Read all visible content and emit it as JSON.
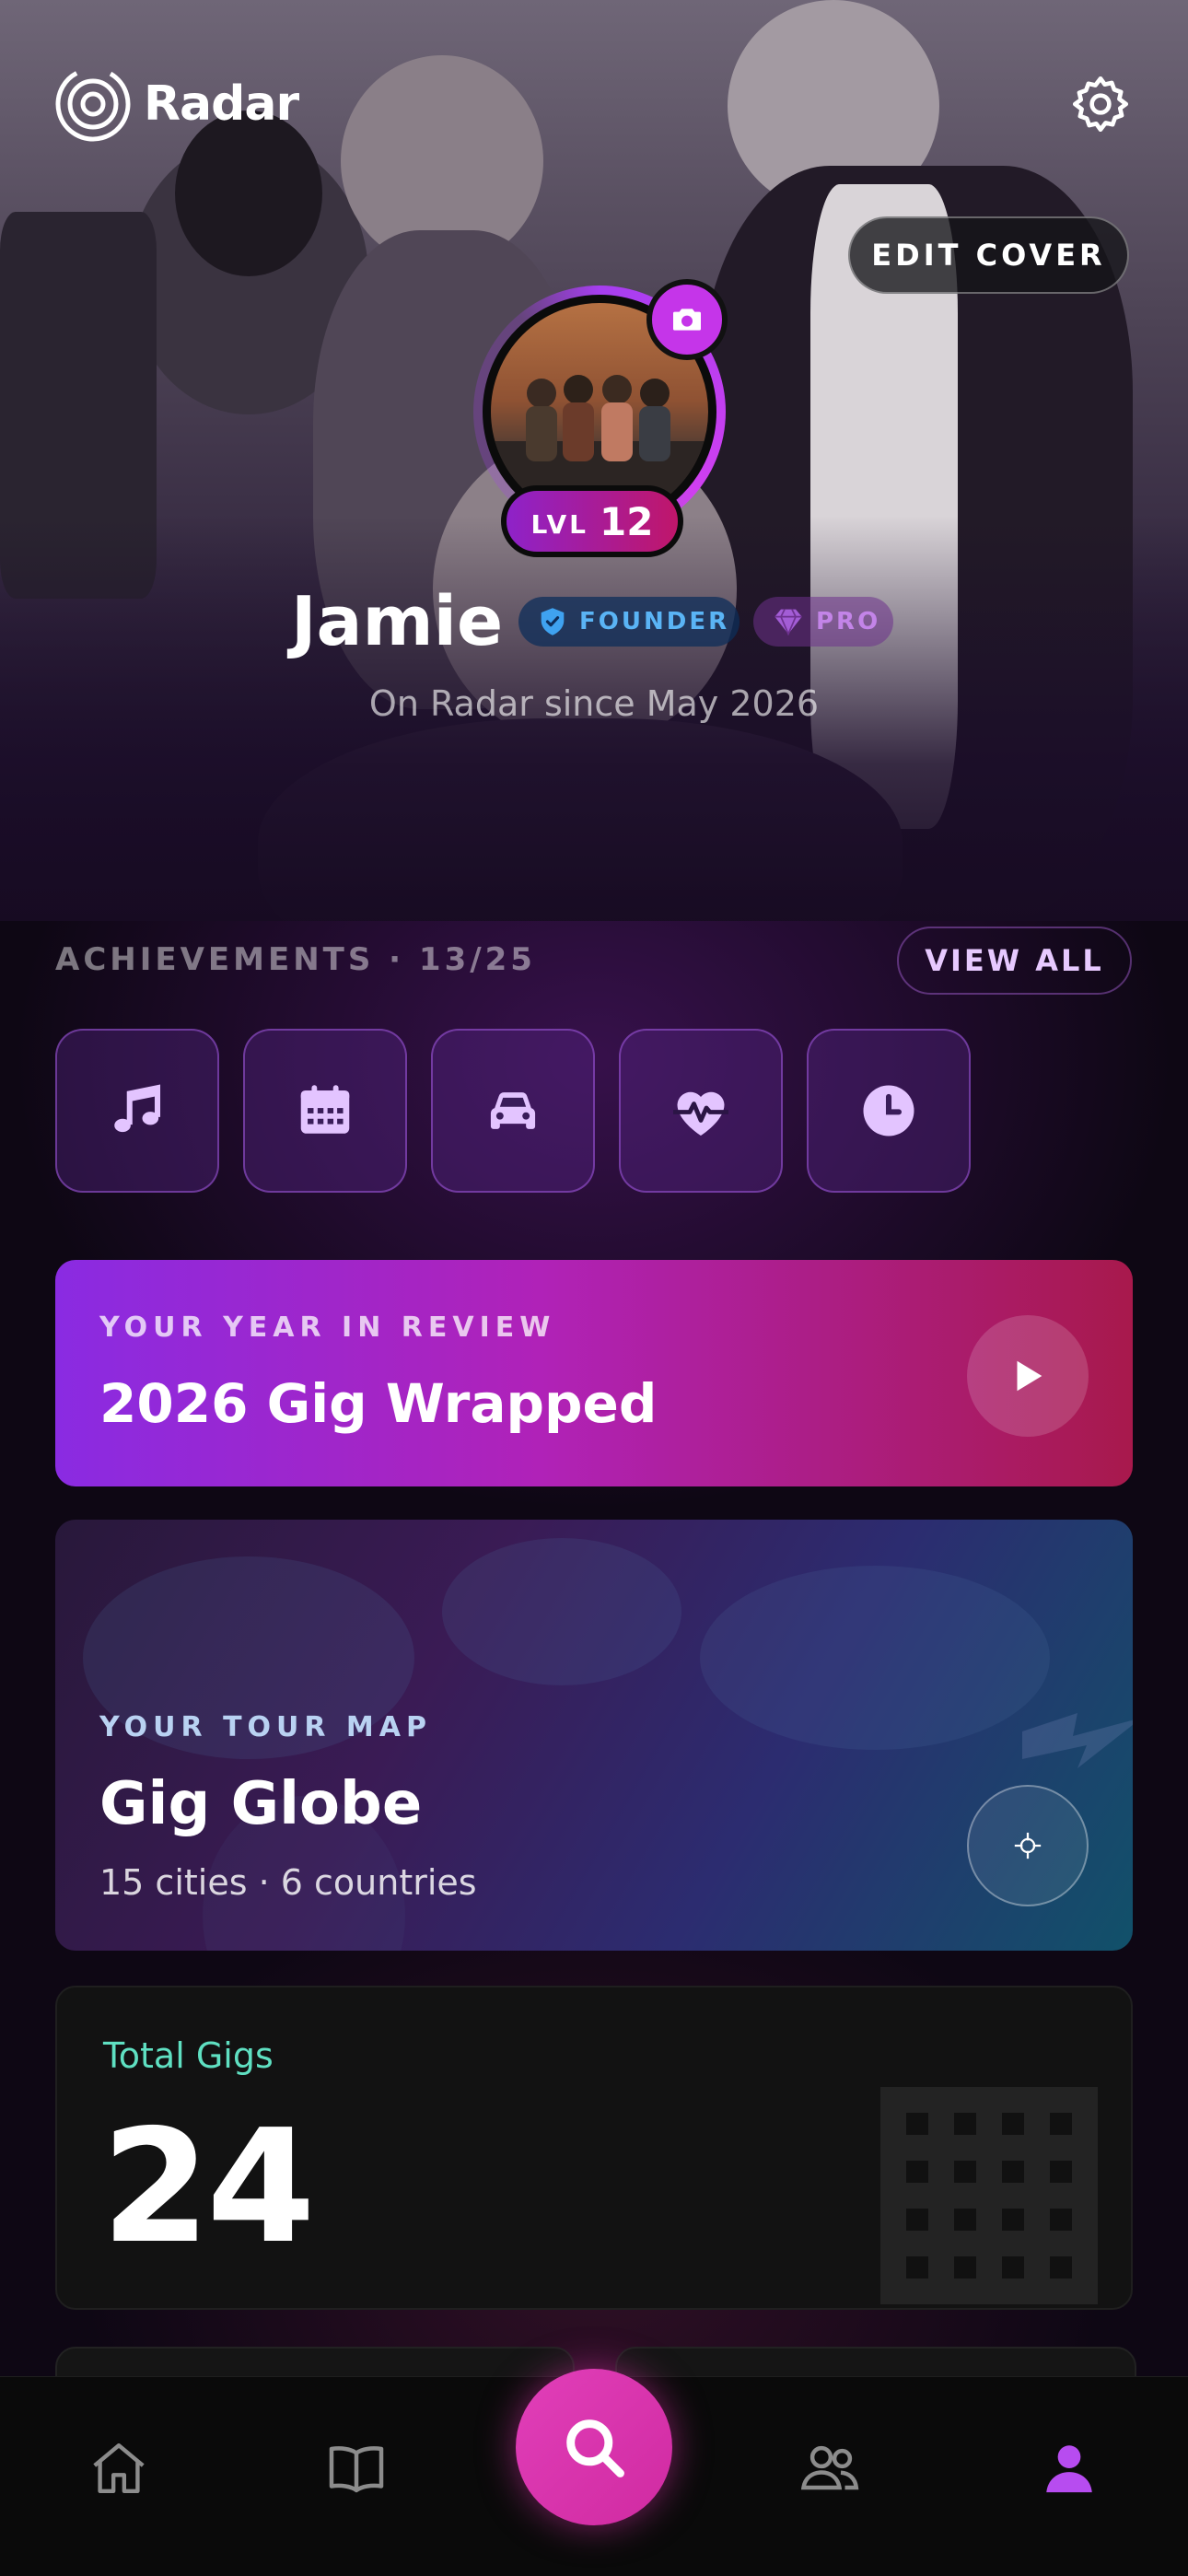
{
  "app": {
    "name": "Radar"
  },
  "cover": {
    "edit_label": "EDIT COVER"
  },
  "profile": {
    "name": "Jamie",
    "level_label": "LVL",
    "level_value": "12",
    "badges": [
      {
        "label": "FOUNDER",
        "icon": "shield-check-icon",
        "color": "#5ab4f5"
      },
      {
        "label": "PRO",
        "icon": "diamond-icon",
        "color": "#c384e8"
      }
    ],
    "since": "On Radar since May 2026"
  },
  "achievements": {
    "title": "ACHIEVEMENTS · 13/25",
    "view_all_label": "VIEW ALL",
    "items": [
      {
        "icon": "music-note-icon"
      },
      {
        "icon": "calendar-icon"
      },
      {
        "icon": "car-icon"
      },
      {
        "icon": "heart-pulse-icon"
      },
      {
        "icon": "clock-icon"
      }
    ]
  },
  "wrapped_card": {
    "kicker": "YOUR YEAR IN REVIEW",
    "title": "2026 Gig Wrapped"
  },
  "globe_card": {
    "kicker": "YOUR TOUR MAP",
    "title": "Gig Globe",
    "subtitle": "15 cities · 6 countries"
  },
  "stats": {
    "total_gigs_label": "Total Gigs",
    "total_gigs_value": "24"
  },
  "nav": {
    "items": [
      {
        "icon": "home-icon",
        "active": false
      },
      {
        "icon": "book-icon",
        "active": false
      },
      {
        "icon": "search-icon",
        "active": false
      },
      {
        "icon": "friends-icon",
        "active": false
      },
      {
        "icon": "profile-icon",
        "active": true
      }
    ]
  },
  "colors": {
    "accent_purple": "#a63ef0",
    "accent_pink": "#e13fb9",
    "teal_label": "#5fe0c2",
    "active_nav": "#b74cf0"
  }
}
